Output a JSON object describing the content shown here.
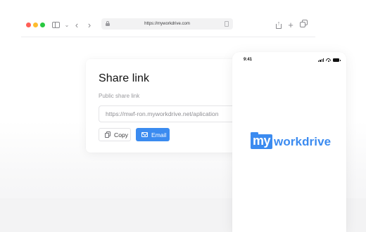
{
  "browser": {
    "url": "https://myworkdrive.com",
    "icons": {
      "sidebar": "sidebar-icon",
      "tab_menu": "chevron-down-icon",
      "back": "chevron-left-icon",
      "forward": "chevron-right-icon",
      "lock": "lock-icon",
      "reader": "reader-icon",
      "share": "share-icon",
      "new_tab": "plus-icon",
      "tabs": "tabs-icon"
    },
    "glyphs": {
      "chevron_down": "⌄",
      "back": "‹",
      "forward": "›",
      "share_arrow": "↑",
      "new_tab": "+"
    }
  },
  "share_dialog": {
    "title": "Share link",
    "subtitle": "Public share link",
    "link_value": "https://mwf-ron.myworkdrive.net/aplication",
    "copy_label": "Copy",
    "email_label": "Email"
  },
  "phone": {
    "time": "9:41",
    "logo": {
      "badge": "my",
      "word": "workdrive"
    }
  },
  "colors": {
    "accent": "#3b8bf0",
    "traffic_red": "#ff5f57",
    "traffic_yellow": "#febc2e",
    "traffic_green": "#28c840"
  }
}
